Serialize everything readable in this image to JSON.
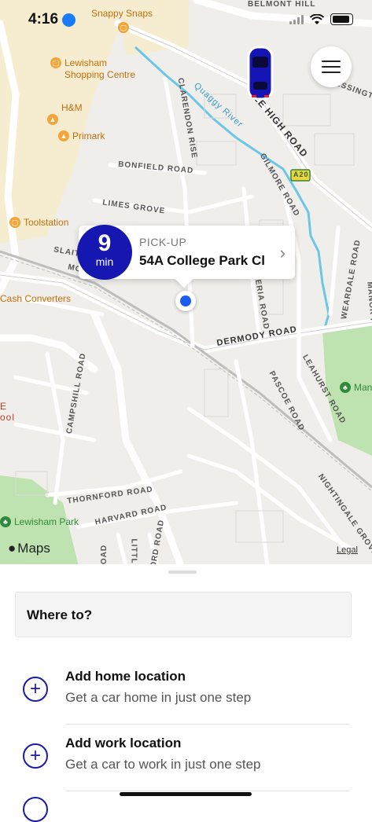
{
  "status_bar": {
    "time": "4:16"
  },
  "map": {
    "labels": {
      "belmont_hill": "BELMONT HILL",
      "blessington": "BLESSINGTO",
      "lee_high_road": "LEE HIGH ROAD",
      "quaggy_river": "Quaggy River",
      "clarendon_rise": "CLARENDON RISE",
      "bonfield_road": "BONFIELD ROAD",
      "gilmore_road": "GILMORE ROAD",
      "limes_grove": "LIMES GROVE",
      "a20": "A20",
      "weardale_road": "WEARDALE ROAD",
      "manor": "MANOR P",
      "slaithwaite": "SLAITH",
      "more": "MORE",
      "dermody_road": "DERMODY ROAD",
      "ateria_road": "ATERIA ROAD",
      "leahurst_road": "LEAHURST ROAD",
      "pascoe_road": "PASCOE ROAD",
      "campshill_road": "CAMPSHILL ROAD",
      "thornford_road": "THORNFORD ROAD",
      "harvard_road": "HARVARD ROAD",
      "nightingale_grove": "NIGHTINGALE GROVE",
      "ford_road": "FORD ROAD",
      "little": "LITTLE",
      "oad": "OAD",
      "e_ool": "E\nool"
    },
    "pois": {
      "snappy_snaps": "Snappy Snaps",
      "lewisham_shopping_centre": "Lewisham\nShopping Centre",
      "hm": "H&M",
      "primark": "Primark",
      "toolstation": "Toolstation",
      "cash_converters": "Cash Converters",
      "lewisham_park": "Lewisham Park",
      "manor": "Man"
    },
    "maps_logo": "Maps",
    "legal": "Legal"
  },
  "pickup": {
    "eta_value": "9",
    "eta_unit": "min",
    "label": "PICK-UP",
    "address": "54A College Park Cl"
  },
  "sheet": {
    "where_to": "Where to?",
    "options": [
      {
        "title": "Add home location",
        "subtitle": "Get a car home in just one step"
      },
      {
        "title": "Add work location",
        "subtitle": "Get a car to work in just one step"
      }
    ]
  },
  "colors": {
    "brand": "#1616b0",
    "accent": "#1a1aaa",
    "pin": "#1a5cf0"
  }
}
